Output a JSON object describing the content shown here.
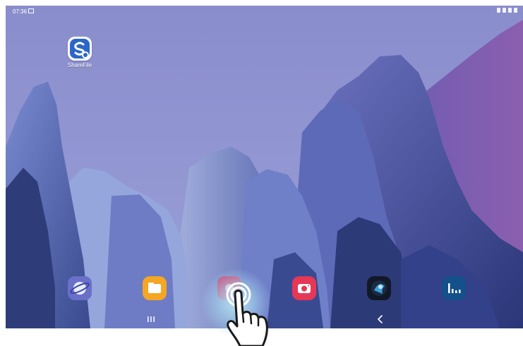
{
  "statusbar": {
    "time": "07:36",
    "icons": [
      "image-icon",
      "sync-icon",
      "wifi-icon",
      "battery-icon"
    ]
  },
  "desktop": {
    "apps": [
      {
        "label": "ShareFile",
        "icon": "sharefile-icon",
        "color": "#2d66c8"
      }
    ]
  },
  "dock": {
    "apps": [
      {
        "icon": "internet-browser-icon",
        "color": "#5a67c8"
      },
      {
        "icon": "my-files-icon",
        "color": "#f5a623"
      },
      {
        "icon": "gallery-icon",
        "color": "#c94c7a"
      },
      {
        "icon": "camera-icon",
        "color": "#e63757"
      },
      {
        "icon": "game-icon",
        "color": "#111827"
      },
      {
        "icon": "analytics-icon",
        "color": "#14508a"
      }
    ]
  },
  "navbar": {
    "buttons": [
      "recent-apps-button",
      "home-button",
      "back-button"
    ]
  },
  "overlay": {
    "gesture": "tap"
  },
  "colors": {
    "wallpaper_sky": "#8c8ec8",
    "mountain_light": "#6a7ac0",
    "mountain_dark": "#2e3d7a"
  }
}
